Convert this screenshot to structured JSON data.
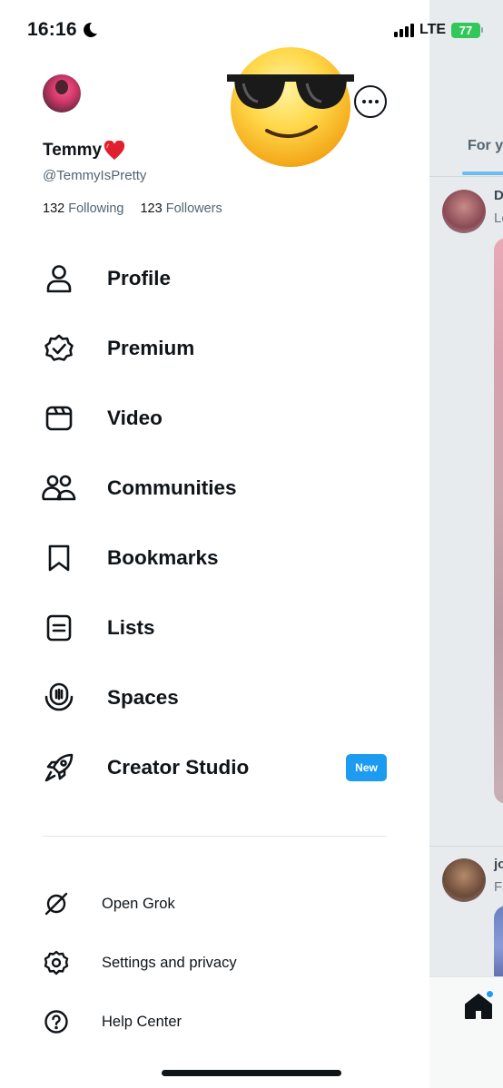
{
  "status_bar": {
    "time": "16:16",
    "network": "LTE",
    "battery": "77"
  },
  "profile": {
    "display_name": "Temmy",
    "handle": "@TemmyIsPretty",
    "following_count": "132",
    "following_label": "Following",
    "followers_count": "123",
    "followers_label": "Followers"
  },
  "menu": {
    "items": [
      {
        "label": "Profile",
        "icon": "person-icon"
      },
      {
        "label": "Premium",
        "icon": "verified-badge-icon"
      },
      {
        "label": "Video",
        "icon": "video-clapper-icon"
      },
      {
        "label": "Communities",
        "icon": "communities-icon"
      },
      {
        "label": "Bookmarks",
        "icon": "bookmark-icon"
      },
      {
        "label": "Lists",
        "icon": "list-icon"
      },
      {
        "label": "Spaces",
        "icon": "spaces-mic-icon"
      },
      {
        "label": "Creator Studio",
        "icon": "rocket-icon",
        "badge": "New"
      }
    ]
  },
  "secondary_menu": {
    "items": [
      {
        "label": "Open Grok",
        "icon": "grok-icon"
      },
      {
        "label": "Settings and privacy",
        "icon": "gear-icon"
      },
      {
        "label": "Help Center",
        "icon": "help-icon"
      }
    ]
  },
  "timeline_peek": {
    "tab_label": "For yo",
    "posts": [
      {
        "name": "D",
        "handle": "Lo"
      },
      {
        "name": "jo",
        "handle": "Fa"
      }
    ]
  },
  "colors": {
    "accent": "#1d9bf0",
    "text": "#0f1419",
    "secondary_text": "#536471",
    "battery": "#32c759"
  }
}
